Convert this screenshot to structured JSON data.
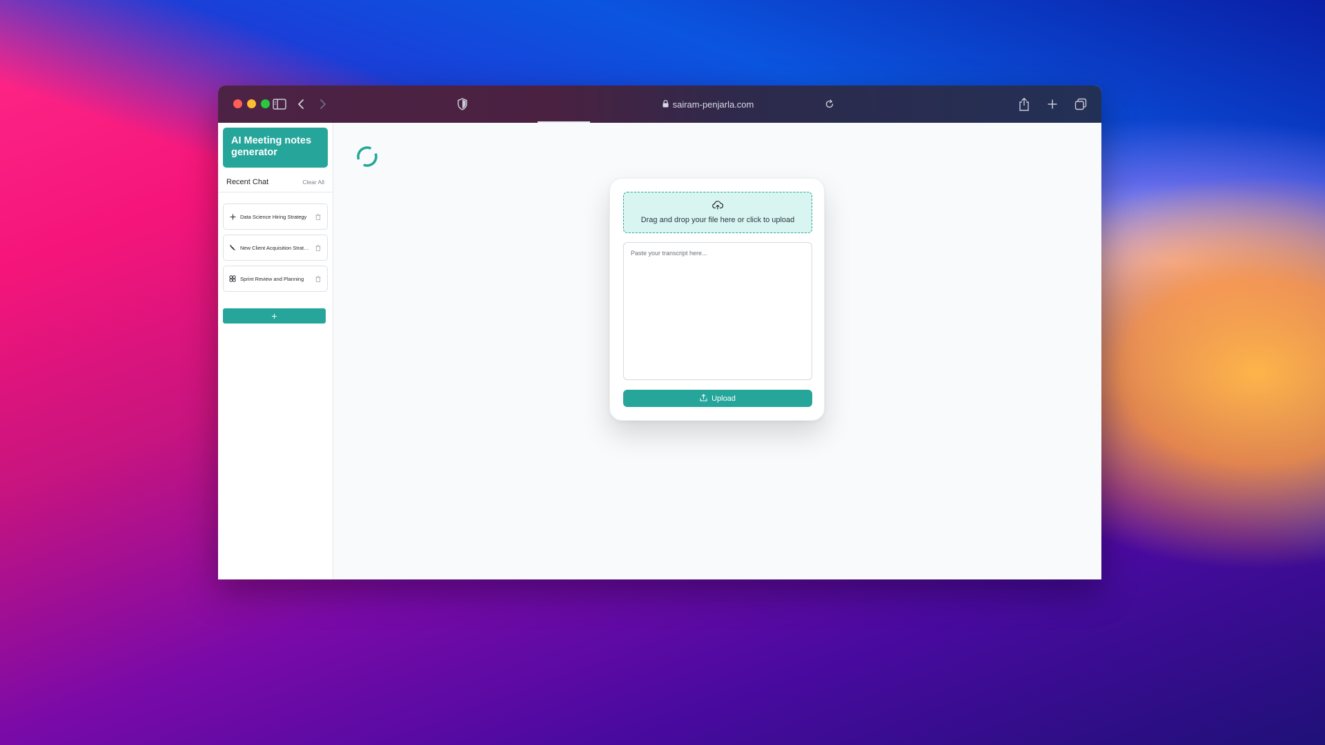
{
  "browser": {
    "url": "sairam-penjarla.com"
  },
  "sidebar": {
    "app_title": "AI Meeting notes generator",
    "recent_label": "Recent Chat",
    "clear_all_label": "Clear All",
    "chats": [
      {
        "label": "Data Science Hiring Strategy",
        "icon": "plus-icon"
      },
      {
        "label": "New Client Acquisition Strategy",
        "icon": "scribble-icon"
      },
      {
        "label": "Sprint Review and Planning",
        "icon": "grid-icon"
      }
    ],
    "new_chat_label": "+"
  },
  "upload": {
    "dropzone_text": "Drag and drop your file here or click to upload",
    "transcript_placeholder": "Paste your transcript here...",
    "button_label": "Upload"
  },
  "colors": {
    "accent": "#26a69a",
    "dropzone_bg": "#d9f5f2"
  }
}
